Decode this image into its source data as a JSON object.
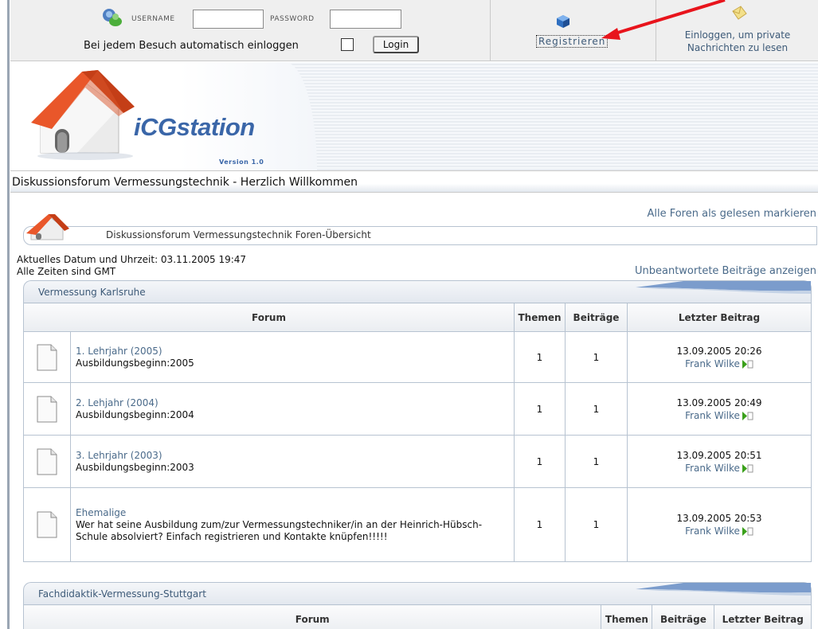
{
  "login": {
    "username_label": "USERNAME",
    "password_label": "PASSWORD",
    "username_value": "",
    "password_value": "",
    "auto_login_label": "Bei jedem Besuch automatisch einloggen",
    "login_button": "Login"
  },
  "register_link": "Registrieren",
  "private_messages_text": "Einloggen, um private Nachrichten zu lesen",
  "logo": {
    "name": "iCGstation",
    "version": "Version 1.0"
  },
  "welcome": "Diskussionsforum Vermessungstechnik - Herzlich Willkommen",
  "mark_all_read": "Alle Foren als gelesen markieren",
  "breadcrumb": "Diskussionsforum Vermessungstechnik Foren-Übersicht",
  "current_datetime": "Aktuelles Datum und Uhrzeit: 03.11.2005 19:47",
  "timezone": "Alle Zeiten sind GMT",
  "unanswered_link": "Unbeantwortete Beiträge anzeigen",
  "columns": {
    "forum": "Forum",
    "topics": "Themen",
    "posts": "Beiträge",
    "last_post": "Letzter Beitrag"
  },
  "categories": [
    {
      "title": "Vermessung Karlsruhe",
      "forums": [
        {
          "name": "1. Lehrjahr (2005)",
          "description": "Ausbildungsbeginn:2005",
          "topics": "1",
          "posts": "1",
          "last_date": "13.09.2005 20:26",
          "last_user": "Frank Wilke"
        },
        {
          "name": "2. Lehjahr (2004)",
          "description": "Ausbildungsbeginn:2004",
          "topics": "1",
          "posts": "1",
          "last_date": "13.09.2005 20:49",
          "last_user": "Frank Wilke"
        },
        {
          "name": "3. Lehrjahr (2003)",
          "description": "Ausbildungsbeginn:2003",
          "topics": "1",
          "posts": "1",
          "last_date": "13.09.2005 20:51",
          "last_user": "Frank Wilke"
        },
        {
          "name": "Ehemalige",
          "description": "Wer hat seine Ausbildung zum/zur Vermessungstechniker/in an der Heinrich-Hübsch-Schule absolviert? Einfach registrieren und Kontakte knüpfen!!!!!",
          "topics": "1",
          "posts": "1",
          "last_date": "13.09.2005 20:53",
          "last_user": "Frank Wilke"
        }
      ]
    },
    {
      "title": "Fachdidaktik-Vermessung-Stuttgart",
      "forums": []
    }
  ],
  "colors": {
    "link": "#4a6a8a",
    "logo_blue": "#3a66a8",
    "border": "#b7c3d1",
    "arrow": "#e8141c"
  }
}
